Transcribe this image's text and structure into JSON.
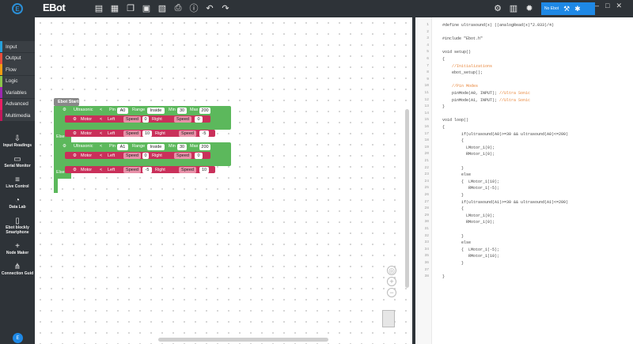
{
  "app": {
    "brand": "EBot"
  },
  "toolbar": {
    "icons": [
      "new-file-icon",
      "open-icon",
      "copy-icon",
      "save-icon",
      "save-as-icon",
      "print-icon",
      "info-icon",
      "undo-icon",
      "redo-icon"
    ],
    "right_icons": [
      "gear-icon",
      "layout-icon",
      "chip-icon"
    ],
    "no_ebot_label": "No Ebot"
  },
  "window_controls": [
    "–",
    "□",
    "✕"
  ],
  "categories": [
    {
      "label": "Input",
      "color": "#26a0da"
    },
    {
      "label": "Output",
      "color": "#e74c3c"
    },
    {
      "label": "Flow",
      "color": "#f39c12"
    },
    {
      "label": "Logic",
      "color": "#8bc34a"
    },
    {
      "label": "Variables",
      "color": "#9c27b0"
    },
    {
      "label": "Advanced",
      "color": "#e91e63"
    },
    {
      "label": "Multimedia",
      "color": "#c2185b"
    }
  ],
  "tools": [
    {
      "label": "Input Readings",
      "icon": "inbox-icon",
      "glyph": "⇩"
    },
    {
      "label": "Serial Monitor",
      "icon": "monitor-icon",
      "glyph": "▭"
    },
    {
      "label": "Live Control",
      "icon": "sliders-icon",
      "glyph": "≡"
    },
    {
      "label": "Data Lab",
      "icon": "pie-icon",
      "glyph": "◔"
    },
    {
      "label": "Ebot blockly Smartphone",
      "icon": "phone-icon",
      "glyph": "▯"
    },
    {
      "label": "Node Maker",
      "icon": "plus-icon",
      "glyph": "+"
    },
    {
      "label": "Connection Guid",
      "icon": "network-icon",
      "glyph": "⋔"
    }
  ],
  "blocks": {
    "start_label": "Ebot Start",
    "else1": "Else",
    "else2": "Else",
    "if1": {
      "sensor": "Ultrasonic",
      "op": "<",
      "pin_label": "Pin",
      "pin": "A0",
      "range_label": "Range",
      "range": "Inside",
      "min_label": "Min",
      "min": "30",
      "max_label": "Max",
      "max": "200"
    },
    "motor1": {
      "name": "Motor",
      "op": "<",
      "left_label": "Left",
      "speed1_label": "Speed",
      "speed1": "0",
      "right_label": "Right",
      "speed2_label": "Speed",
      "speed2": "0"
    },
    "motor2": {
      "name": "Motor",
      "op": "<",
      "left_label": "Left",
      "speed1_label": "Speed",
      "speed1": "10",
      "right_label": "Right",
      "speed2_label": "Speed",
      "speed2": "-5"
    },
    "if2": {
      "sensor": "Ultrasonic",
      "op": "<",
      "pin_label": "Pin",
      "pin": "A1",
      "range_label": "Range",
      "range": "Inside",
      "min_label": "Min",
      "min": "30",
      "max_label": "Max",
      "max": "200"
    },
    "motor3": {
      "name": "Motor",
      "op": "<",
      "left_label": "Left",
      "speed1_label": "Speed",
      "speed1": "0",
      "right_label": "Right",
      "speed2_label": "Speed",
      "speed2": "0"
    },
    "motor4": {
      "name": "Motor",
      "op": "<",
      "left_label": "Left",
      "speed1_label": "Speed",
      "speed1": "-5",
      "right_label": "Right",
      "speed2_label": "Speed",
      "speed2": "10"
    }
  },
  "code": [
    {
      "n": "1",
      "t": "#define ultrasound(x) ((analogRead(x)*2.033)/4)"
    },
    {
      "n": "2",
      "t": ""
    },
    {
      "n": "3",
      "t": "#include \"Ebot.h\""
    },
    {
      "n": "4",
      "t": ""
    },
    {
      "n": "5",
      "t": "void setup()"
    },
    {
      "n": "6",
      "t": "{"
    },
    {
      "n": "7",
      "t": "    //Initializations",
      "c": true
    },
    {
      "n": "8",
      "t": "    ebot_setup();"
    },
    {
      "n": "9",
      "t": ""
    },
    {
      "n": "10",
      "t": "    //Pin Modes",
      "c": true
    },
    {
      "n": "11",
      "t": "    pinMode(A0, INPUT); ",
      "cm": "//Ultra Sonic"
    },
    {
      "n": "12",
      "t": "    pinMode(A1, INPUT); ",
      "cm": "//Ultra Sonic"
    },
    {
      "n": "13",
      "t": "}"
    },
    {
      "n": "14",
      "t": ""
    },
    {
      "n": "15",
      "t": "void loop()"
    },
    {
      "n": "16",
      "t": "{"
    },
    {
      "n": "17",
      "t": "        if(ultrasound(A0)>=30 && ultrasound(A0)<=200)"
    },
    {
      "n": "18",
      "t": "        {"
    },
    {
      "n": "19",
      "t": "          LMotor_1(0);"
    },
    {
      "n": "20",
      "t": "          RMotor_1(0);"
    },
    {
      "n": "21",
      "t": ""
    },
    {
      "n": "22",
      "t": "        }"
    },
    {
      "n": "23",
      "t": "        else"
    },
    {
      "n": "24",
      "t": "        {  LMotor_1(10);"
    },
    {
      "n": "25",
      "t": "           RMotor_1(-5);"
    },
    {
      "n": "26",
      "t": "        }"
    },
    {
      "n": "27",
      "t": "        if(ultrasound(A1)>=30 && ultrasound(A1)<=200)"
    },
    {
      "n": "28",
      "t": "        {"
    },
    {
      "n": "29",
      "t": "          LMotor_1(0);"
    },
    {
      "n": "30",
      "t": "          RMotor_1(0);"
    },
    {
      "n": "31",
      "t": ""
    },
    {
      "n": "32",
      "t": "        }"
    },
    {
      "n": "33",
      "t": "        else"
    },
    {
      "n": "34",
      "t": "        {  LMotor_1(-5);"
    },
    {
      "n": "35",
      "t": "           RMotor_1(10);"
    },
    {
      "n": "36",
      "t": "        }"
    },
    {
      "n": "37",
      "t": ""
    },
    {
      "n": "38",
      "t": "}"
    }
  ],
  "colors": {
    "topbar": "#2e3338",
    "accent": "#1e88e5",
    "green_block": "#5cb85c",
    "motor_block": "#c9305a"
  }
}
